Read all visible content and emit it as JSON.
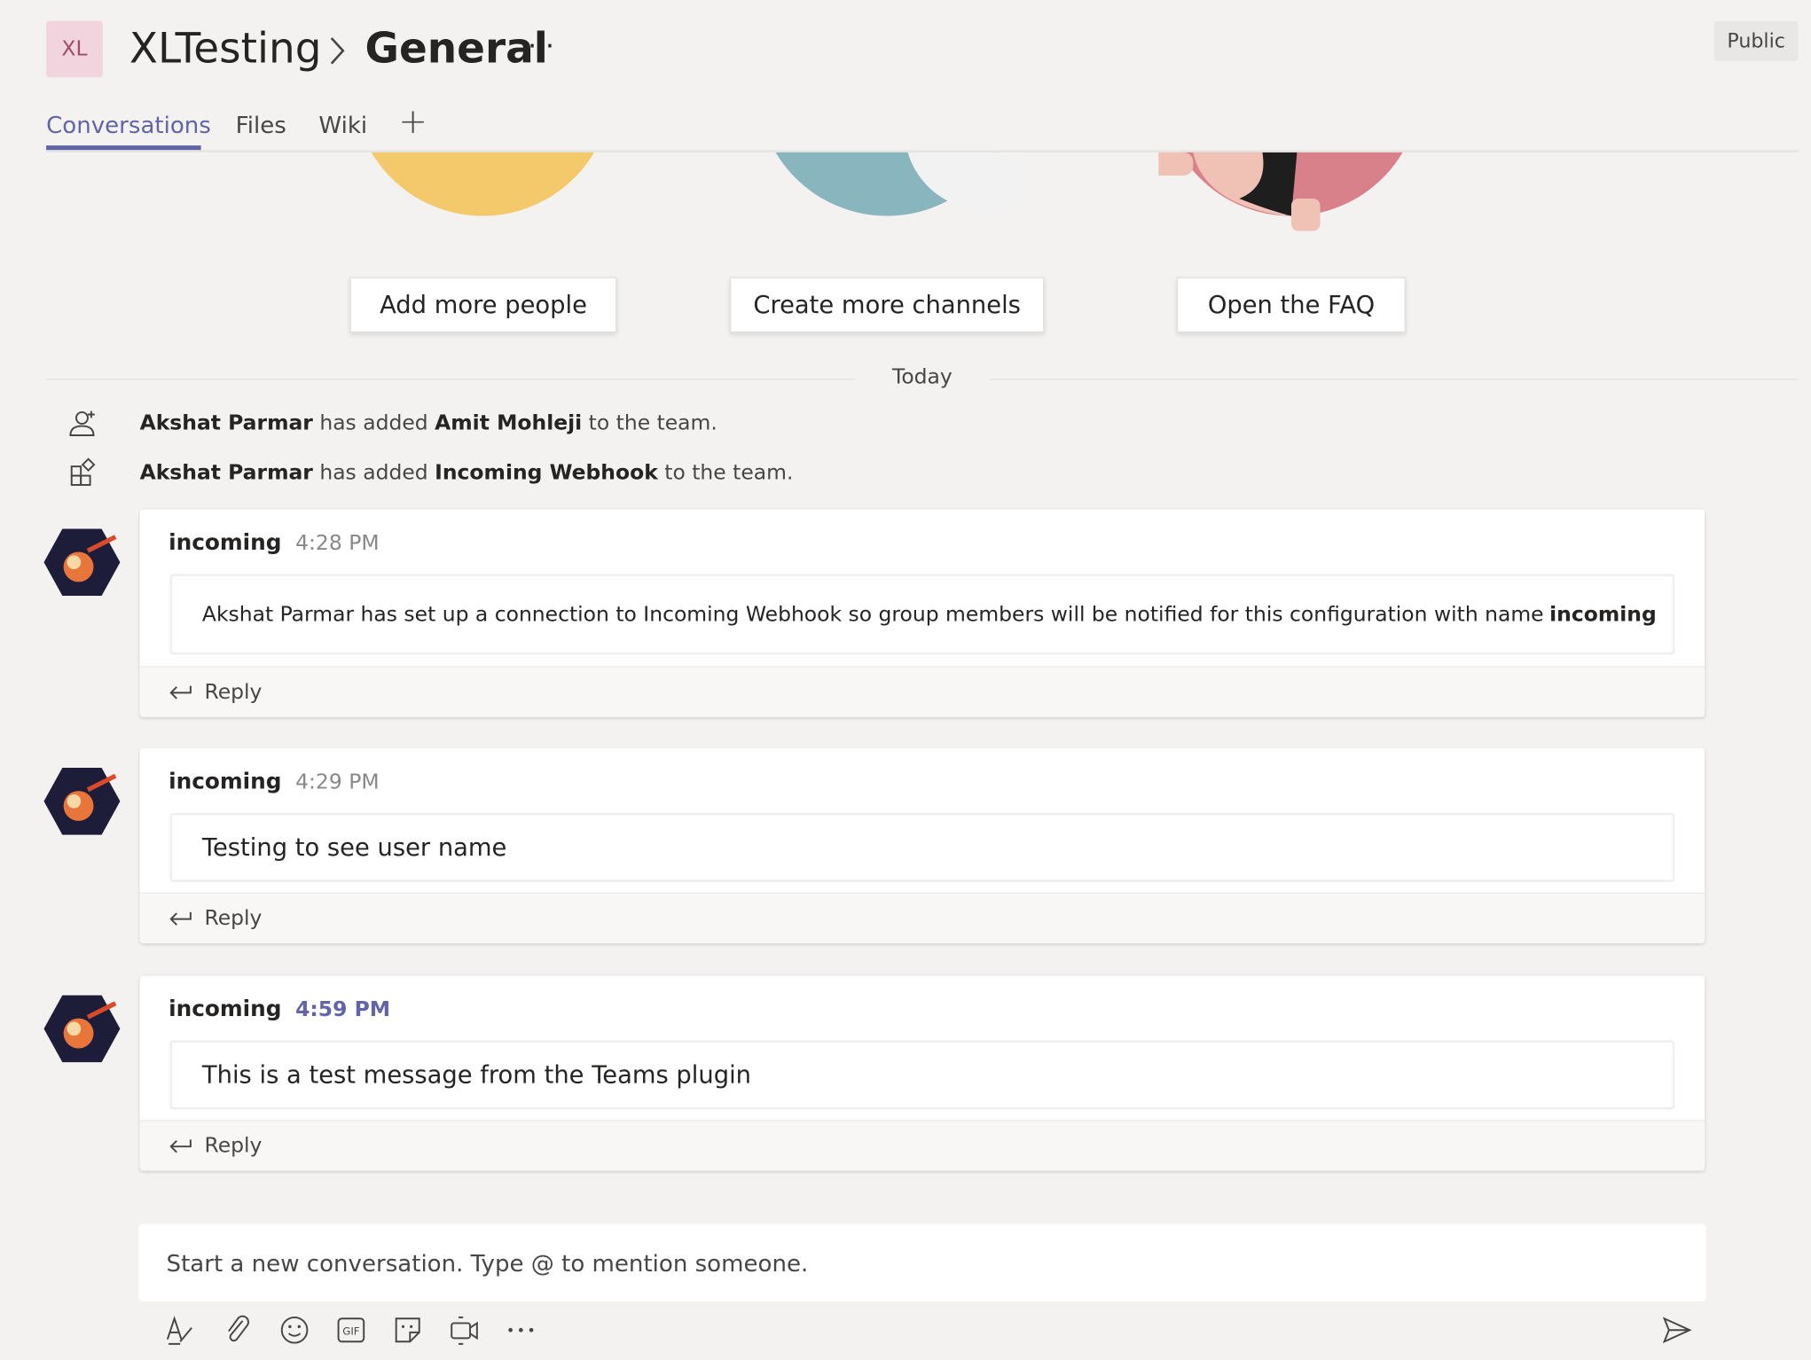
{
  "header": {
    "team_initials": "XL",
    "team_name": "XLTesting",
    "channel_name": "General",
    "more_label": "···",
    "visibility": "Public"
  },
  "tabs": [
    {
      "label": "Conversations",
      "active": true
    },
    {
      "label": "Files"
    },
    {
      "label": "Wiki"
    },
    {
      "label": "+"
    }
  ],
  "welcome_actions": [
    "Add more people",
    "Create more channels",
    "Open the FAQ"
  ],
  "divider_label": "Today",
  "events": [
    {
      "actor": "Akshat Parmar",
      "verb": " has added ",
      "target": "Amit Mohleji",
      "suffix": " to the team.",
      "icon": "add-person-icon"
    },
    {
      "actor": "Akshat Parmar",
      "verb": " has added ",
      "target": "Incoming Webhook",
      "suffix": " to the team.",
      "icon": "apps-icon"
    }
  ],
  "messages": [
    {
      "sender": "incoming",
      "time": "4:28 PM",
      "text": "Akshat Parmar has set up a connection to Incoming Webhook so group members will be notified for this configuration with name ",
      "bold_suffix": "incoming",
      "reply": "Reply"
    },
    {
      "sender": "incoming",
      "time": "4:29 PM",
      "text": "Testing to see user name",
      "reply": "Reply"
    },
    {
      "sender": "incoming",
      "time": "4:59 PM",
      "text": "This is a test message from the Teams plugin",
      "reply": "Reply"
    }
  ],
  "compose": {
    "placeholder": "Start a new conversation. Type @ to mention someone."
  },
  "toolbar_icons": [
    "format-icon",
    "attach-icon",
    "emoji-icon",
    "gif-icon",
    "sticker-icon",
    "meet-now-icon",
    "more-options-icon",
    "send-icon"
  ],
  "colors": {
    "accent": "#6264a7",
    "background": "#f3f2f1"
  }
}
